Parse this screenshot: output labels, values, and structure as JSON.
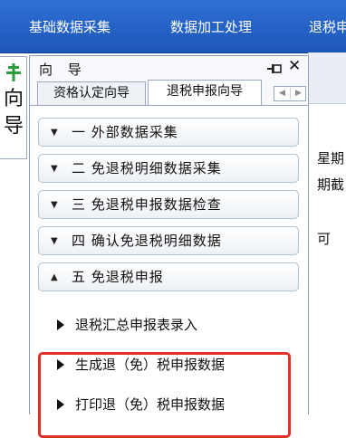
{
  "menubar": {
    "items": [
      "基础数据采集",
      "数据加工处理",
      "退税申"
    ]
  },
  "side_tab": {
    "label_line1": "向",
    "label_line2": "导"
  },
  "panel": {
    "title": "向 导",
    "tabs": [
      "资格认定向导",
      "退税申报向导"
    ],
    "active_tab": 1,
    "steps": [
      {
        "label": "一 外部数据采集",
        "state": "collapsed"
      },
      {
        "label": "二 免退税明细数据采集",
        "state": "collapsed"
      },
      {
        "label": "三 免退税申报数据检查",
        "state": "collapsed"
      },
      {
        "label": "四 确认免退税明细数据",
        "state": "collapsed"
      },
      {
        "label": "五 免退税申报",
        "state": "expanded"
      }
    ],
    "subitems": [
      "退税汇总申报表录入",
      "生成退（免）税申报数据",
      "打印退（免）税申报数据"
    ]
  },
  "background_window": {
    "line1": "星期",
    "line2": "期截",
    "line3": "可"
  },
  "colors": {
    "menubar": "#2563c9",
    "highlight_box": "#e0302a",
    "pin_green": "#2a9d3a"
  }
}
